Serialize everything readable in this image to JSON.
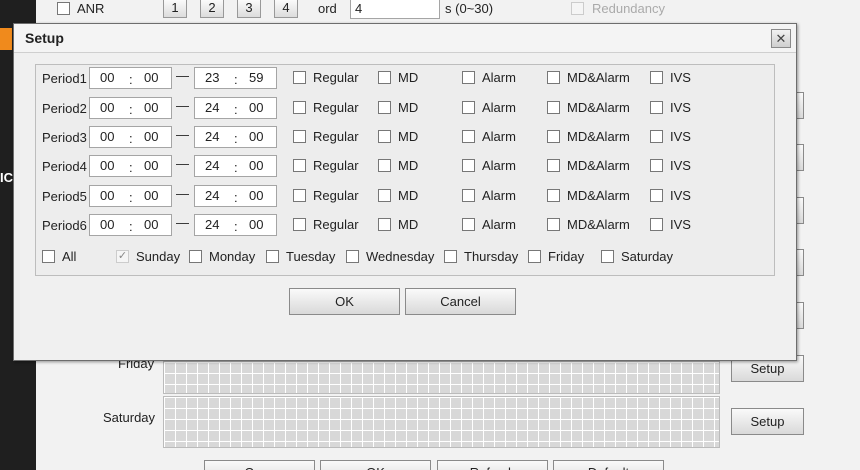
{
  "background": {
    "left_text": "IC",
    "top_bar": {
      "anr_label": "ANR",
      "pages": [
        "1",
        "2",
        "3",
        "4"
      ],
      "record_label": "ord",
      "record_value": "4",
      "record_unit": "s (0~30)",
      "redundancy_label": "Redundancy"
    },
    "day_rows": [
      {
        "label": "Friday",
        "setup": "Setup"
      },
      {
        "label": "Saturday",
        "setup": "Setup"
      }
    ],
    "bottom_buttons": [
      "Copy",
      "OK",
      "Refresh",
      "Default"
    ]
  },
  "dialog": {
    "title": "Setup",
    "close_glyph": "✕",
    "separator": "—",
    "colon": ":",
    "periods": [
      {
        "label": "Period1",
        "start_h": "00",
        "start_m": "00",
        "end_h": "23",
        "end_m": "59"
      },
      {
        "label": "Period2",
        "start_h": "00",
        "start_m": "00",
        "end_h": "24",
        "end_m": "00"
      },
      {
        "label": "Period3",
        "start_h": "00",
        "start_m": "00",
        "end_h": "24",
        "end_m": "00"
      },
      {
        "label": "Period4",
        "start_h": "00",
        "start_m": "00",
        "end_h": "24",
        "end_m": "00"
      },
      {
        "label": "Period5",
        "start_h": "00",
        "start_m": "00",
        "end_h": "24",
        "end_m": "00"
      },
      {
        "label": "Period6",
        "start_h": "00",
        "start_m": "00",
        "end_h": "24",
        "end_m": "00"
      }
    ],
    "record_types": [
      "Regular",
      "MD",
      "Alarm",
      "MD&Alarm",
      "IVS"
    ],
    "days": [
      {
        "label": "All",
        "checked": false,
        "disabled": false
      },
      {
        "label": "Sunday",
        "checked": true,
        "disabled": true
      },
      {
        "label": "Monday",
        "checked": false,
        "disabled": false
      },
      {
        "label": "Tuesday",
        "checked": false,
        "disabled": false
      },
      {
        "label": "Wednesday",
        "checked": false,
        "disabled": false
      },
      {
        "label": "Thursday",
        "checked": false,
        "disabled": false
      },
      {
        "label": "Friday",
        "checked": false,
        "disabled": false
      },
      {
        "label": "Saturday",
        "checked": false,
        "disabled": false
      }
    ],
    "ok_label": "OK",
    "cancel_label": "Cancel"
  }
}
